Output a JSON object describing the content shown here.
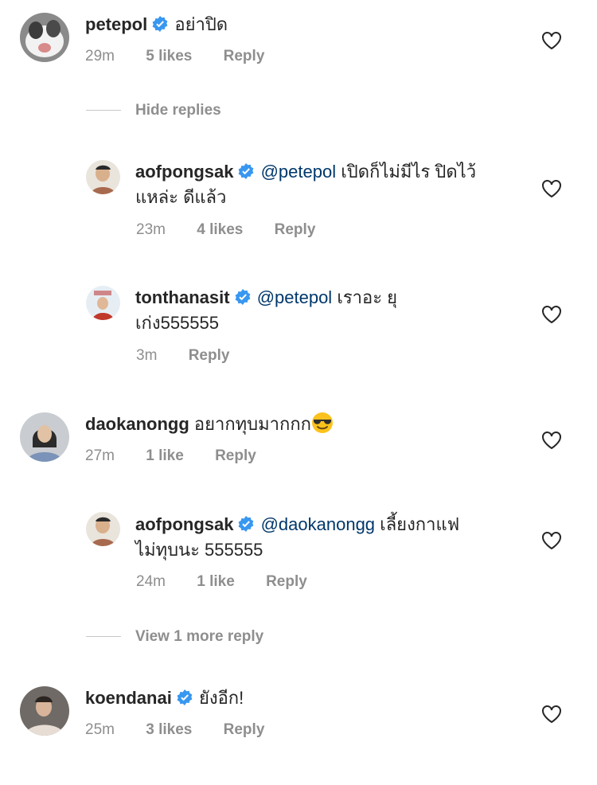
{
  "comments": [
    {
      "username": "petepol",
      "verified": true,
      "text": "อย่าปิด",
      "time": "29m",
      "likes": "5 likes",
      "reply": "Reply"
    },
    {
      "username": "aofpongsak",
      "verified": true,
      "mention": "@petepol",
      "text_line1": "เปิดก็ไม่มีไร ปิดไว้",
      "text_line2": "แหล่ะ ดีแล้ว",
      "time": "23m",
      "likes": "4 likes",
      "reply": "Reply"
    },
    {
      "username": "tonthanasit",
      "verified": true,
      "mention": "@petepol",
      "text_line1": "เราอะ ยุ",
      "text_line2": "เก่ง555555",
      "time": "3m",
      "reply": "Reply"
    },
    {
      "username": "daokanongg",
      "verified": false,
      "text": "อยากทุบมากกก",
      "emoji": "smiling-face-with-sunglasses",
      "time": "27m",
      "likes": "1 like",
      "reply": "Reply"
    },
    {
      "username": "aofpongsak",
      "verified": true,
      "mention": "@daokanongg",
      "text_line1": "เลี้ยงกาแฟ",
      "text_line2": "ไม่ทุบนะ 555555",
      "time": "24m",
      "likes": "1 like",
      "reply": "Reply"
    },
    {
      "username": "koendanai",
      "verified": true,
      "text": "ยังอีก!",
      "time": "25m",
      "likes": "3 likes",
      "reply": "Reply"
    }
  ],
  "toggles": {
    "hide_replies": "Hide replies",
    "view_more": "View 1 more reply"
  },
  "colors": {
    "verified_badge": "#3897f0",
    "mention": "#00376b",
    "meta": "#8e8e8e"
  }
}
